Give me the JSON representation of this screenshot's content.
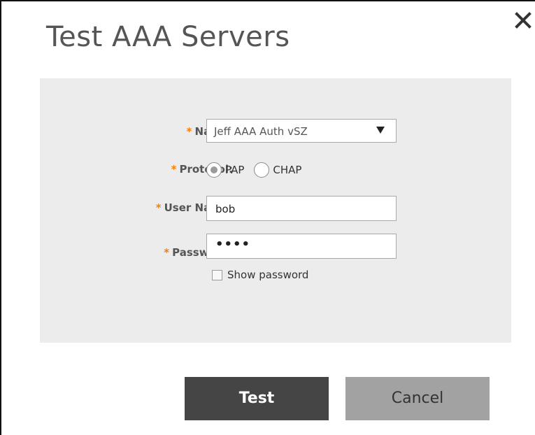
{
  "dialog": {
    "title": "Test AAA Servers",
    "close_icon": "close-icon"
  },
  "form": {
    "required_marker": "*",
    "name": {
      "label": "Name:",
      "selected": "Jeff AAA Auth vSZ"
    },
    "protocol": {
      "label": "Protocol:",
      "options": [
        "PAP",
        "CHAP"
      ],
      "selected": "PAP"
    },
    "user_name": {
      "label": "User Name:",
      "value": "bob"
    },
    "password": {
      "label": "Password:",
      "masked_value": "••••"
    },
    "show_password": {
      "label": "Show password",
      "checked": false
    }
  },
  "buttons": {
    "test": "Test",
    "cancel": "Cancel"
  },
  "colors": {
    "required": "#f0810f",
    "panel_bg": "#ececec",
    "test_bg": "#454545",
    "cancel_bg": "#a2a2a2"
  }
}
